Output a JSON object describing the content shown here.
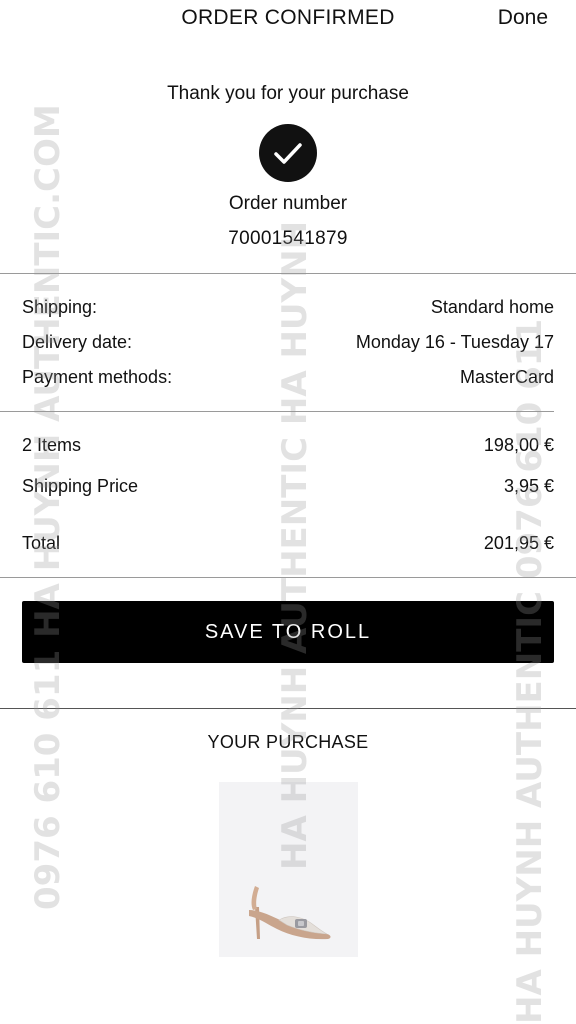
{
  "header": {
    "title": "ORDER CONFIRMED",
    "done_label": "Done"
  },
  "confirmation": {
    "thank_you": "Thank you for your purchase",
    "order_number_label": "Order number",
    "order_number": "70001541879"
  },
  "details": [
    {
      "label": "Shipping:",
      "value": "Standard home"
    },
    {
      "label": "Delivery date:",
      "value": "Monday 16 - Tuesday 17"
    },
    {
      "label": "Payment methods:",
      "value": "MasterCard"
    }
  ],
  "summary": {
    "items": {
      "label": "2 Items",
      "value": "198,00 €"
    },
    "shipping": {
      "label": "Shipping Price",
      "value": "3,95 €"
    },
    "total": {
      "label": "Total",
      "value": "201,95 €"
    }
  },
  "save_button_label": "SAVE TO ROLL",
  "purchase": {
    "title": "YOUR PURCHASE",
    "product_icon": "slingback-heel-shoe"
  },
  "watermarks": {
    "left": "0976 610 611   HA HUYNH AUTHENTIC.COM",
    "middle": "HA HUYNH AUTHENTIC   HA HUYNH",
    "right": "HA HUYNH AUTHENTIC   0976 610 611"
  },
  "colors": {
    "button_bg": "#000000",
    "button_text": "#ffffff",
    "divider": "#9a9a9a"
  }
}
